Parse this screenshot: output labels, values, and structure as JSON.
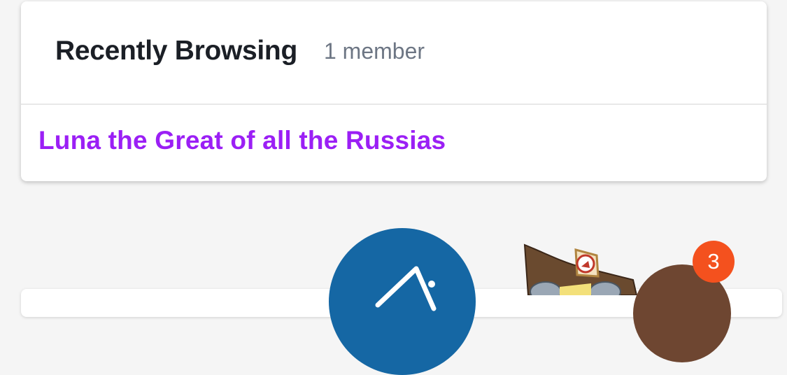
{
  "recently_browsing": {
    "title": "Recently Browsing",
    "count": "1 member",
    "members": [
      {
        "name": "Luna the Great of all the Russias",
        "color": "#9b1ff5"
      }
    ]
  },
  "floating": {
    "chat_icon": "megaphone-icon",
    "chat_color": "#1567a4",
    "notification_count": "3",
    "badge_color": "#f4511e"
  }
}
